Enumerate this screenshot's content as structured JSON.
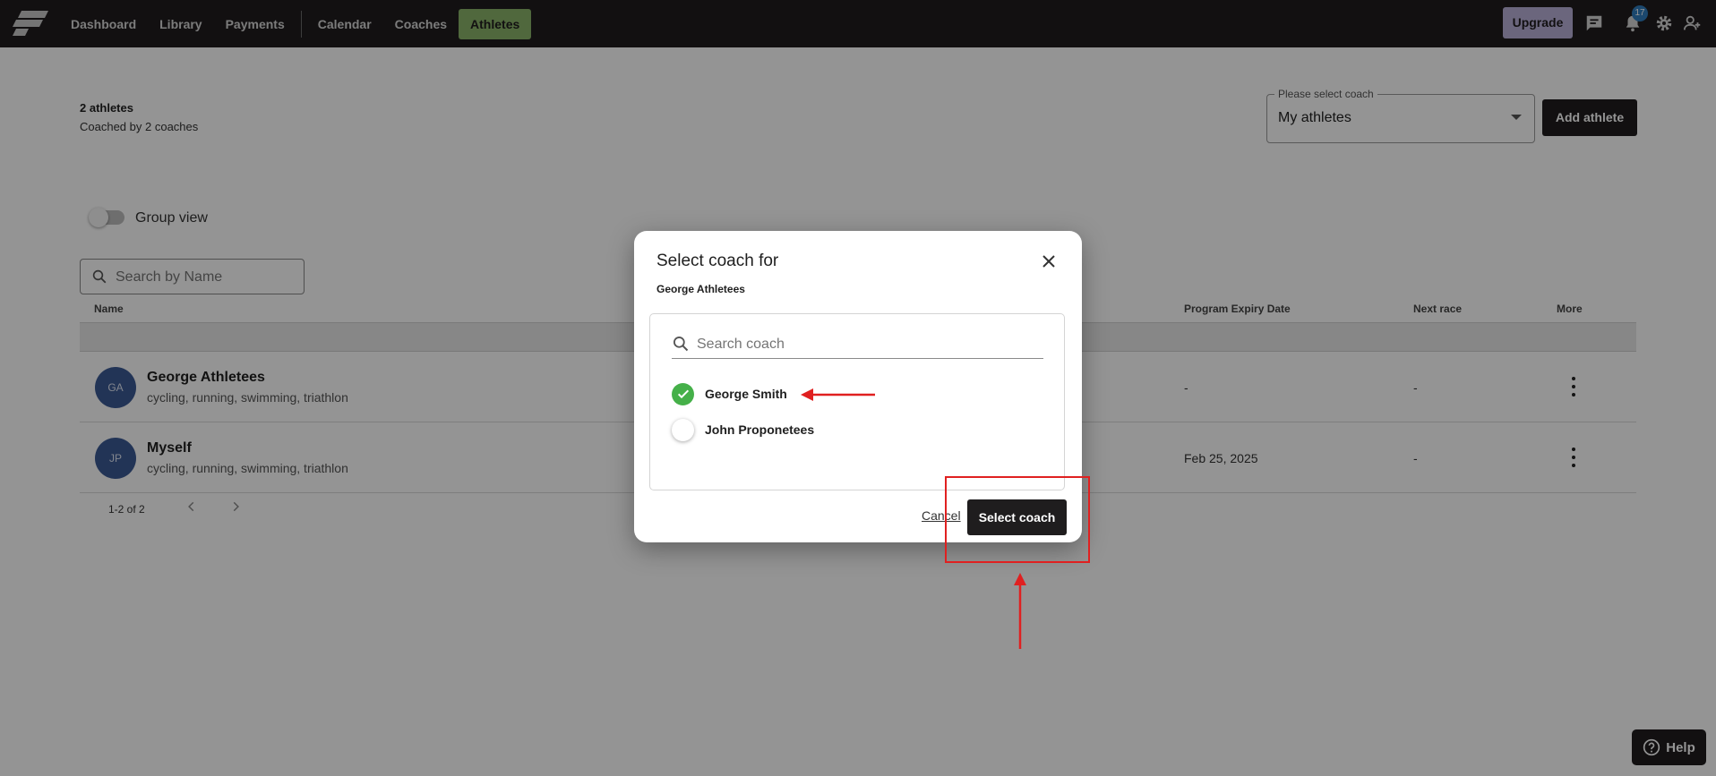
{
  "nav": {
    "items": [
      {
        "label": "Dashboard"
      },
      {
        "label": "Library"
      },
      {
        "label": "Payments"
      },
      {
        "label": "Calendar"
      },
      {
        "label": "Coaches"
      },
      {
        "label": "Athletes",
        "active": true
      }
    ],
    "upgrade_label": "Upgrade",
    "notification_count": "17",
    "icons": [
      "chat-icon",
      "bell-icon",
      "gear-icon",
      "add-user-icon"
    ]
  },
  "summary": {
    "count": "2 athletes",
    "subtitle": "Coached by 2 coaches"
  },
  "coach_filter": {
    "label": "Please select coach",
    "value": "My athletes"
  },
  "add_athlete_label": "Add athlete",
  "group_view_label": "Group view",
  "search": {
    "placeholder": "Search by Name"
  },
  "table": {
    "headers": {
      "name": "Name",
      "expiry": "Program Expiry Date",
      "next_race": "Next race",
      "more": "More"
    },
    "rows": [
      {
        "initials": "GA",
        "name": "George Athletees",
        "sports": "cycling, running, swimming, triathlon",
        "expiry": "-",
        "next_race": "-"
      },
      {
        "initials": "JP",
        "name": "Myself",
        "sports": "cycling, running, swimming, triathlon",
        "expiry": "Feb 25, 2025",
        "next_race": "-"
      }
    ],
    "pagination": "1-2 of 2"
  },
  "help_label": "Help",
  "modal": {
    "title": "Select coach for",
    "subtitle": "George Athletees",
    "search_placeholder": "Search coach",
    "options": [
      {
        "label": "George Smith",
        "selected": true
      },
      {
        "label": "John Proponetees",
        "selected": false
      }
    ],
    "cancel_label": "Cancel",
    "confirm_label": "Select coach"
  },
  "colors": {
    "topbar": "#1f1d1e",
    "active_tab": "#8bb36a",
    "upgrade": "#b8b0d8",
    "check": "#45b049",
    "annotation": "#e02020",
    "avatar": "#3c5a95"
  }
}
